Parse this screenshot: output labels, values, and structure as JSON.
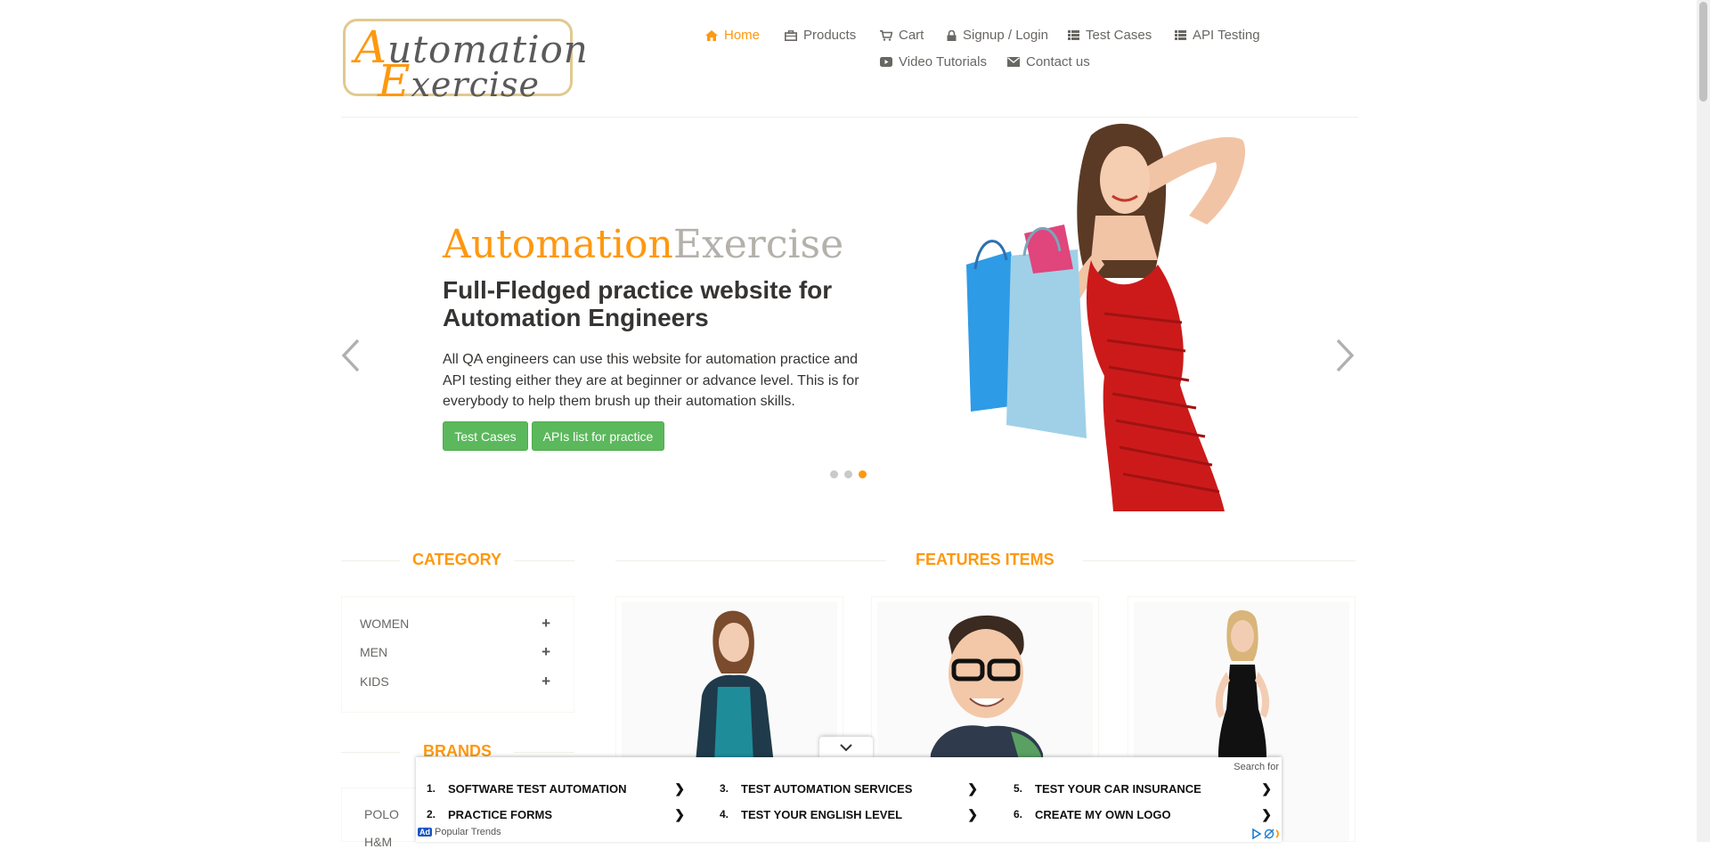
{
  "logo": {
    "line1_cap": "A",
    "line1_rest": "utomation",
    "line2_cap": "E",
    "line2_rest": "xercise"
  },
  "nav": {
    "items": [
      {
        "label": "Home",
        "icon": "home-icon",
        "active": true
      },
      {
        "label": "Products",
        "icon": "briefcase-icon"
      },
      {
        "label": "Cart",
        "icon": "cart-icon"
      },
      {
        "label": "Signup / Login",
        "icon": "lock-icon"
      },
      {
        "label": "Test Cases",
        "icon": "list-icon"
      },
      {
        "label": "API Testing",
        "icon": "list-icon"
      },
      {
        "label": "Video Tutorials",
        "icon": "youtube-play-icon"
      },
      {
        "label": "Contact us",
        "icon": "envelope-icon"
      }
    ],
    "active_color": "#fe980f"
  },
  "slider": {
    "brand_part1": "Automation",
    "brand_part2": "Exercise",
    "title": "Full-Fledged practice website for Automation Engineers",
    "description": "All QA engineers can use this website for automation practice and API testing either they are at beginner or advance level. This is for everybody to help them brush up their automation skills.",
    "buttons": [
      "Test Cases",
      "APIs list for practice"
    ],
    "indicator_count": 3,
    "active_indicator": 3,
    "prev_icon": "chevron-left-icon",
    "next_icon": "chevron-right-icon"
  },
  "sidebar": {
    "category_title": "CATEGORY",
    "categories": [
      "WOMEN",
      "MEN",
      "KIDS"
    ],
    "brands_title": "BRANDS",
    "brands": [
      "POLO",
      "H&M"
    ]
  },
  "features": {
    "title": "FEATURES ITEMS"
  },
  "ad": {
    "search_label": "Search for",
    "items": [
      {
        "num": "1.",
        "text": "SOFTWARE TEST AUTOMATION"
      },
      {
        "num": "2.",
        "text": "PRACTICE FORMS"
      },
      {
        "num": "3.",
        "text": "TEST AUTOMATION SERVICES"
      },
      {
        "num": "4.",
        "text": "TEST YOUR ENGLISH LEVEL"
      },
      {
        "num": "5.",
        "text": "TEST YOUR CAR INSURANCE"
      },
      {
        "num": "6.",
        "text": "CREATE MY OWN LOGO"
      }
    ],
    "badge": "Ad",
    "footer": "Popular Trends"
  },
  "colors": {
    "accent": "#fe980f",
    "button_green": "#5cb85c",
    "text": "#696763"
  }
}
